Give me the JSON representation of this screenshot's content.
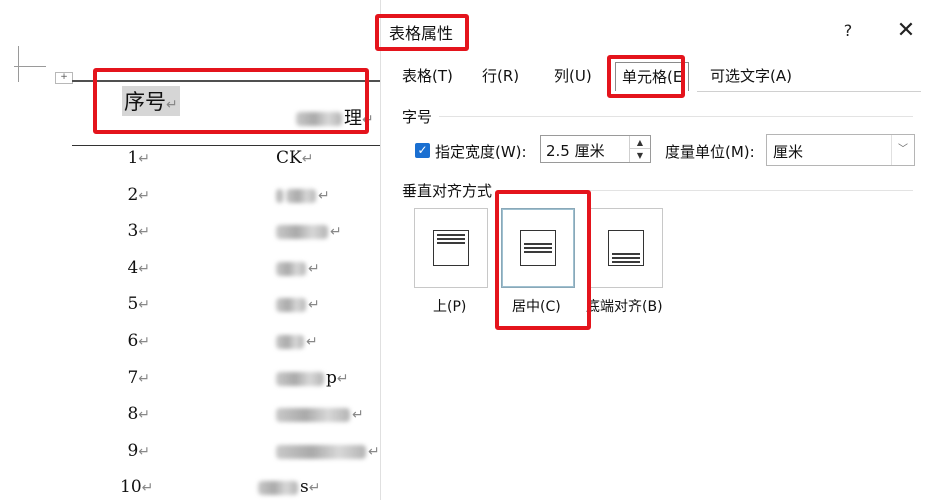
{
  "document": {
    "table_handle": "+",
    "header": {
      "seq": "序号",
      "name_suffix": "理",
      "return_mark": "↵"
    },
    "rows": [
      {
        "num": "1",
        "name_visible": "CK",
        "blur_widths": []
      },
      {
        "num": "2",
        "name_visible": "",
        "blur_widths": [
          8,
          30
        ]
      },
      {
        "num": "3",
        "name_visible": "",
        "blur_widths": [
          52
        ]
      },
      {
        "num": "4",
        "name_visible": "",
        "blur_widths": [
          30
        ]
      },
      {
        "num": "5",
        "name_visible": "",
        "blur_widths": [
          30
        ]
      },
      {
        "num": "6",
        "name_visible": "",
        "blur_widths": [
          28
        ]
      },
      {
        "num": "7",
        "name_visible": "p",
        "blur_widths": [
          48
        ]
      },
      {
        "num": "8",
        "name_visible": "",
        "blur_widths": [
          74
        ]
      },
      {
        "num": "9",
        "name_visible": "",
        "blur_widths": [
          90
        ]
      },
      {
        "num": "10",
        "name_visible": "s",
        "blur_widths": [
          40
        ]
      }
    ]
  },
  "dialog": {
    "title": "表格属性",
    "help": "?",
    "close": "✕",
    "tabs": [
      {
        "label": "表格(T)",
        "active": false
      },
      {
        "label": "行(R)",
        "active": false
      },
      {
        "label": "列(U)",
        "active": false
      },
      {
        "label": "单元格(E",
        "active": true
      },
      {
        "label": "可选文字(A)",
        "active": false
      }
    ],
    "size_section": "字号",
    "preferred_width": {
      "label": "指定宽度(W):",
      "checked": true,
      "value": "2.5 厘米"
    },
    "measure_in": {
      "label": "度量单位(M):",
      "value": "厘米"
    },
    "vertical_alignment": {
      "label": "垂直对齐方式",
      "options": [
        {
          "label": "上(P)",
          "icon": "align-top-icon",
          "selected": false
        },
        {
          "label": "居中(C)",
          "icon": "align-center-icon",
          "selected": true
        },
        {
          "label": "底端对齐(B)",
          "icon": "align-bottom-icon",
          "selected": false
        }
      ]
    }
  },
  "colors": {
    "highlight_box": "#e4141c",
    "checkbox": "#1a6fd1"
  }
}
